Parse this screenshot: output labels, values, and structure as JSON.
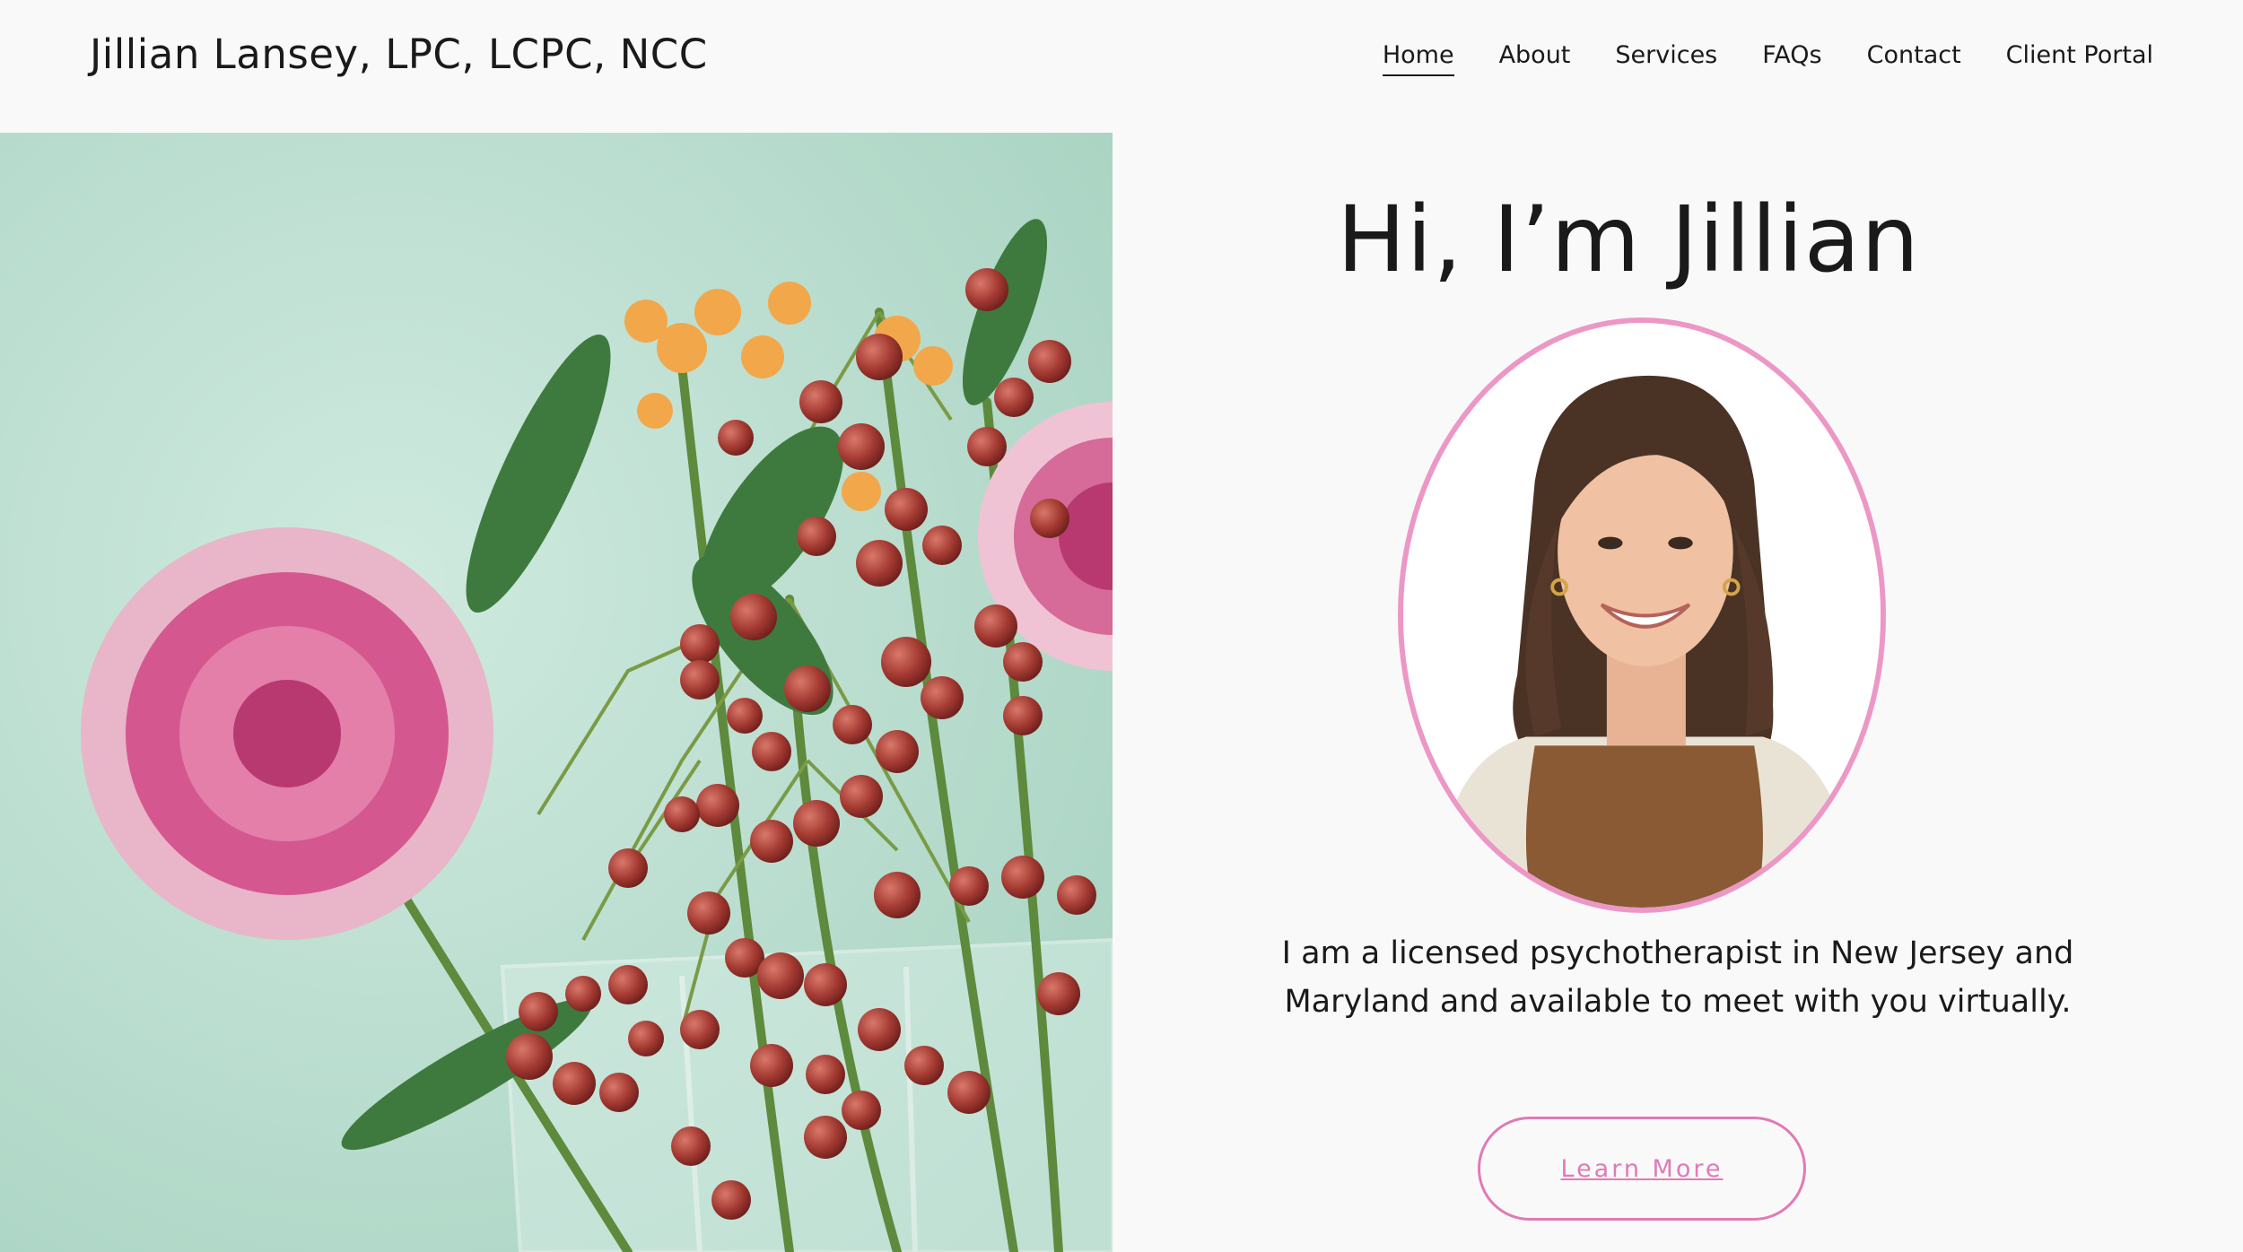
{
  "header": {
    "site_title": "Jillian Lansey, LPC, LCPC, NCC",
    "nav": [
      {
        "label": "Home",
        "active": true
      },
      {
        "label": "About",
        "active": false
      },
      {
        "label": "Services",
        "active": false
      },
      {
        "label": "FAQs",
        "active": false
      },
      {
        "label": "Contact",
        "active": false
      },
      {
        "label": "Client Portal",
        "active": false
      }
    ]
  },
  "hero": {
    "greeting": "Hi, I’m Jillian",
    "bio": "I am a licensed psychotherapist in New Jersey and Maryland and available to meet with you virtually.",
    "cta_label": "Learn More"
  },
  "colors": {
    "background": "#f9f9f9",
    "accent_pink": "#e07ab6",
    "portrait_border": "#ec97c6",
    "image_bg": "#c7e5d8"
  },
  "icons": {
    "hero_image": "flower-arrangement-photo",
    "portrait": "therapist-portrait-photo"
  }
}
